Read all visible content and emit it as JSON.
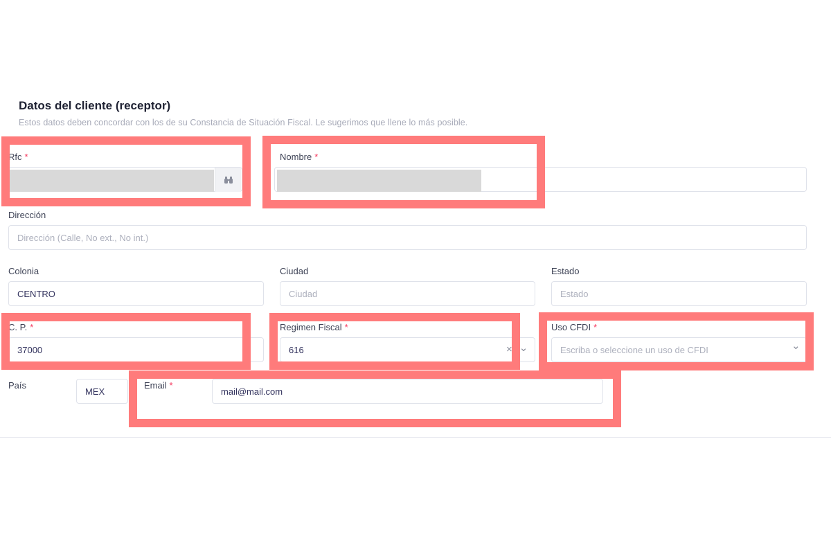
{
  "section": {
    "title": "Datos del cliente (receptor)",
    "subtitle": "Estos datos deben concordar con los de su Constancia de Situación Fiscal. Le sugerimos que llene lo más posible."
  },
  "fields": {
    "rfc": {
      "label": "Rfc",
      "required": "*"
    },
    "nombre": {
      "label": "Nombre",
      "required": "*"
    },
    "direccion": {
      "label": "Dirección",
      "placeholder": "Dirección (Calle, No ext., No int.)"
    },
    "colonia": {
      "label": "Colonia",
      "value": "CENTRO"
    },
    "ciudad": {
      "label": "Ciudad",
      "placeholder": "Ciudad"
    },
    "estado": {
      "label": "Estado",
      "placeholder": "Estado"
    },
    "cp": {
      "label": "C. P.",
      "required": "*",
      "value": "37000"
    },
    "regimen": {
      "label": "Regimen Fiscal",
      "required": "*",
      "value": "616",
      "clear": "×",
      "chevron": "⌄"
    },
    "uso_cfdi": {
      "label": "Uso CFDI",
      "required": "*",
      "placeholder": "Escriba o seleccione un uso de CFDI",
      "chevron": "⌄"
    },
    "pais": {
      "label": "País",
      "value": "MEX"
    },
    "email": {
      "label": "Email",
      "required": "*",
      "value": "mail@mail.com"
    }
  },
  "icons": {
    "search": "binoculars-icon"
  },
  "colors": {
    "highlight": "#ff7b7b",
    "required": "#f5365c",
    "masked": "#d9d9d9"
  }
}
